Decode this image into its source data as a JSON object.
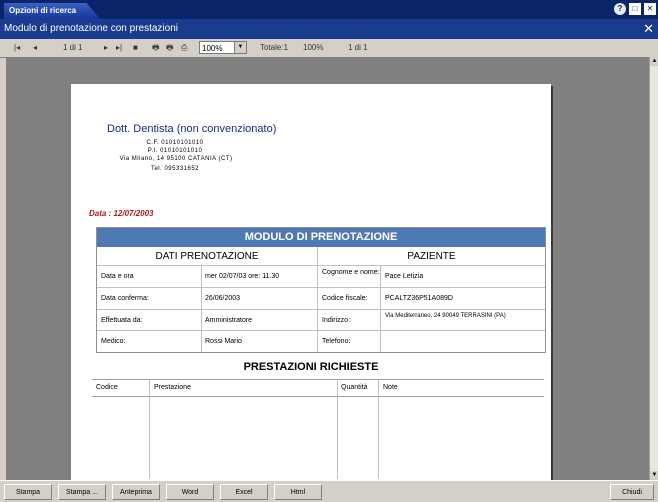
{
  "app": {
    "tab_label": "Opzioni di ricerca"
  },
  "window": {
    "title": "Modulo di prenotazione con prestazioni",
    "close": "✕"
  },
  "toolbar": {
    "first": "|◂",
    "prev": "◂",
    "page_indicator": "1 di 1",
    "next": "▸",
    "last": "▸|",
    "stop": "■",
    "zoom_value": "100%",
    "total": "Totale:1",
    "percent": "100%",
    "page_count": "1 di 1"
  },
  "doc": {
    "doctor": "Dott. Dentista (non convenzionato)",
    "cf": "C.F. 01010101010",
    "piva": "P.I. 01010101010",
    "address": "Via Milano, 14 95100 CATANIA (CT)",
    "tel": "Tel. 095331652",
    "date": "Data : 12/07/2003",
    "form_title": "MODULO DI PRENOTAZIONE",
    "section_left": "DATI PRENOTAZIONE",
    "section_right": "PAZIENTE",
    "rows_left": [
      {
        "label": "Data e ora",
        "value": "mer 02/07/03 ore: 11.30"
      },
      {
        "label": "Data conferma:",
        "value": "26/06/2003"
      },
      {
        "label": "Effettuata da:",
        "value": "Amministratore"
      },
      {
        "label": "Medico:",
        "value": "Rossi Mario"
      }
    ],
    "rows_right": [
      {
        "label": "Cognome e nome:",
        "value": "Pace Letizia"
      },
      {
        "label": "Codice fiscale:",
        "value": "PCALTZ36P51A089D"
      },
      {
        "label": "Indirizzo:",
        "value": "Via Mediterraneo, 24 90049 TERRASINI (PA)"
      },
      {
        "label": "Telefono:",
        "value": ""
      }
    ],
    "prestazioni_title": "PRESTAZIONI RICHIESTE",
    "prestazioni_headers": {
      "code": "Codice",
      "service": "Prestazione",
      "qty": "Quantità",
      "notes": "Note"
    }
  },
  "buttons": {
    "print": "Stampa",
    "print_dialog": "Stampa ...",
    "preview": "Anteprima",
    "word": "Word",
    "excel": "Excel",
    "html": "Html",
    "close": "Chiudi"
  },
  "colors": {
    "header_blue": "#4f79b3",
    "date_red": "#b01818",
    "doctor_blue": "#1a2a8a"
  }
}
